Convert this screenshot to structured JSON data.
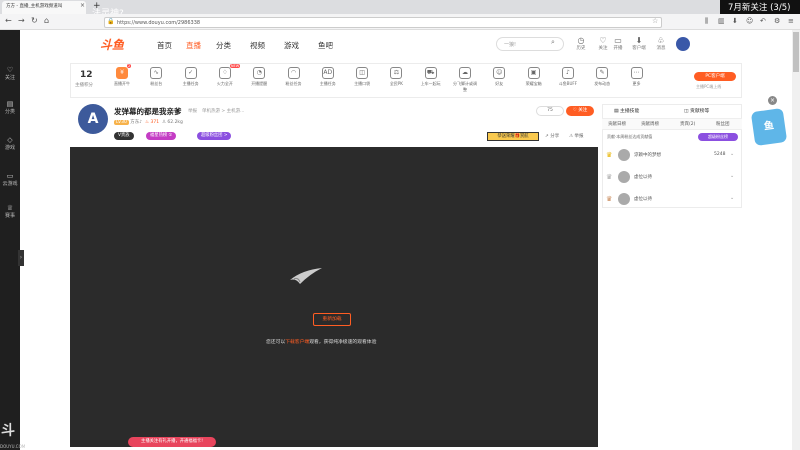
{
  "overlay": {
    "title": "7月新关注 (3/5)",
    "left_text": "法灵神?"
  },
  "browser": {
    "tab_title": "方方 - 直播_主机游戏频道叫",
    "url": "https://www.douyu.com/2986338",
    "new_tab": "+"
  },
  "leftnav": {
    "items": [
      {
        "icon": "♡",
        "label": "关注"
      },
      {
        "icon": "▤",
        "label": "分类"
      },
      {
        "icon": "◇",
        "label": "游戏"
      },
      {
        "icon": "▭",
        "label": "云游戏"
      },
      {
        "icon": "♕",
        "label": "赛事"
      }
    ],
    "handle": "›",
    "watermark": "斗",
    "watermark_small": "DOUYU.COM"
  },
  "header": {
    "logo": "斗鱼",
    "nav": [
      {
        "label": "首页",
        "active": false
      },
      {
        "label": "直播",
        "active": true
      },
      {
        "label": "分类",
        "active": false
      },
      {
        "label": "视频",
        "active": false
      },
      {
        "label": "游戏",
        "active": false
      },
      {
        "label": "鱼吧",
        "active": false
      }
    ],
    "search_placeholder": "一狼!",
    "icons": [
      {
        "icon": "◷",
        "label": "历史"
      },
      {
        "icon": "♡",
        "label": "关注"
      },
      {
        "icon": "▭",
        "label": "开播"
      },
      {
        "icon": "⬇",
        "label": "客户端"
      },
      {
        "icon": "♧",
        "label": "消息"
      }
    ]
  },
  "funcbar": {
    "number": "12",
    "sub": "主播积分",
    "items": [
      {
        "icon": "¥",
        "label": "直播开牛",
        "badge": "2"
      },
      {
        "icon": "∿",
        "label": "粉丝台"
      },
      {
        "icon": "✓",
        "label": "主播任务"
      },
      {
        "icon": "♢",
        "label": "火力全开",
        "badge": "NEW"
      },
      {
        "icon": "◔",
        "label": "开播提醒"
      },
      {
        "icon": "◠",
        "label": "粉丝任务"
      },
      {
        "icon": "AD",
        "label": "主播任务"
      },
      {
        "icon": "◫",
        "label": "主播口袋"
      },
      {
        "icon": "⚖",
        "label": "全民PK"
      },
      {
        "icon": "⛟",
        "label": "上车一起玩"
      },
      {
        "icon": "☁",
        "label": "分飞脚计或调整"
      },
      {
        "icon": "☺",
        "label": "好友"
      },
      {
        "icon": "▣",
        "label": "荣耀宝箱"
      },
      {
        "icon": "♪",
        "label": "斗鱼BUFF"
      },
      {
        "icon": "✎",
        "label": "发布动态"
      },
      {
        "icon": "⋯",
        "label": "更多"
      }
    ],
    "pc_client": "PC客户端",
    "pc_sub": "主播PC端上线"
  },
  "room": {
    "avatar_letter": "A",
    "title": "发弹幕的都是我亲爹",
    "tag1": "举报",
    "tag2": "单机热游 > 主机游...",
    "level": "LV30",
    "anchor": "方东♪",
    "heat": "♨ 371",
    "fans": "♙ 62.2kg",
    "pill_vip": "V贵族",
    "pill_fans": "福星热榜 ①",
    "pill_ext": "超级粉丝团 >",
    "follow_count": "75",
    "follow_label": "♡ 关注",
    "gift": "恭送荣耀🎁赏航",
    "share": "↗ 分享",
    "report": "⚠ 举报"
  },
  "video": {
    "button": "重新加载",
    "msg_pre": "您还可以",
    "msg_link": "下载客户端",
    "msg_post": "观看，获得纯净极速的观看体验"
  },
  "toast": "主播关注有礼开播，开通福福卡!",
  "rightpanel": {
    "tab1": "▤ 主播技能",
    "tab2": "◫ 贡献榜等",
    "subtabs": [
      "贡献日榜",
      "贡献周榜",
      "贵宾(2)",
      "粉丝团"
    ],
    "note": "贡献·本周粉丝达成贡献值",
    "top_button": "超级粉丝榜",
    "ranks": [
      {
        "crown": "♛",
        "name": "涼颖中的梦想",
        "score": "5248",
        "arrow": "⌄",
        "crown_color": "#e8b400"
      },
      {
        "crown": "♛",
        "name": "虚位以待",
        "score": "",
        "arrow": "⌄",
        "crown_color": "#aaa"
      },
      {
        "crown": "♛",
        "name": "虚位以待",
        "score": "",
        "arrow": "⌄",
        "crown_color": "#c98a5a"
      }
    ]
  },
  "mascot": {
    "text": "鱼",
    "close": "×"
  }
}
